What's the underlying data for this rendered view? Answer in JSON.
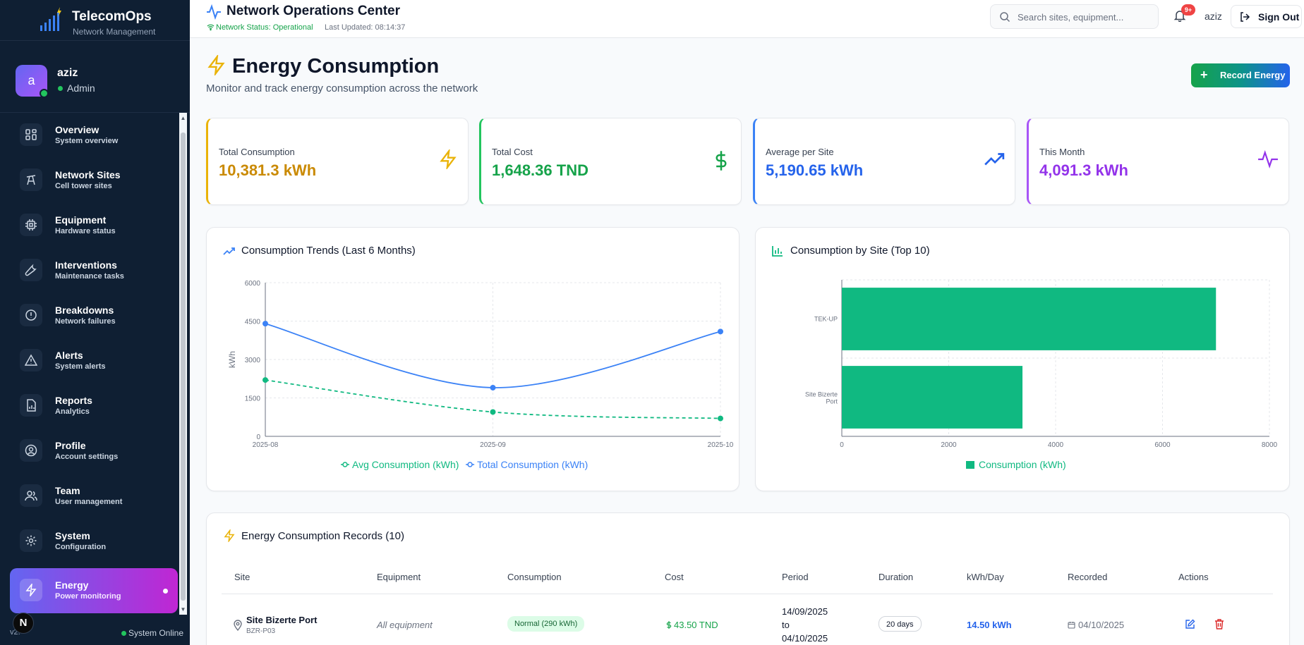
{
  "brand": {
    "name": "TelecomOps",
    "subtitle": "Network Management"
  },
  "user": {
    "initial": "a",
    "name": "aziz",
    "role": "Admin"
  },
  "nav": [
    {
      "label": "Overview",
      "sub": "System overview",
      "icon": "grid-icon"
    },
    {
      "label": "Network Sites",
      "sub": "Cell tower sites",
      "icon": "tower-icon"
    },
    {
      "label": "Equipment",
      "sub": "Hardware status",
      "icon": "chip-icon"
    },
    {
      "label": "Interventions",
      "sub": "Maintenance tasks",
      "icon": "wrench-icon"
    },
    {
      "label": "Breakdowns",
      "sub": "Network failures",
      "icon": "alert-circle-icon"
    },
    {
      "label": "Alerts",
      "sub": "System alerts",
      "icon": "warning-triangle-icon"
    },
    {
      "label": "Reports",
      "sub": "Analytics",
      "icon": "report-icon"
    },
    {
      "label": "Profile",
      "sub": "Account settings",
      "icon": "user-circle-icon"
    },
    {
      "label": "Team",
      "sub": "User management",
      "icon": "users-icon"
    },
    {
      "label": "System",
      "sub": "Configuration",
      "icon": "gear-icon"
    },
    {
      "label": "Energy",
      "sub": "Power monitoring",
      "icon": "bolt-icon",
      "active": true
    }
  ],
  "footer": {
    "version": "v2.",
    "status": "System Online"
  },
  "header": {
    "title": "Network Operations Center",
    "status": "Network Status: Operational",
    "updated": "Last Updated: 08:14:37",
    "search_placeholder": "Search sites, equipment...",
    "notif_badge": "9+",
    "user": "aziz",
    "signout": "Sign Out"
  },
  "page": {
    "title": "Energy Consumption",
    "subtitle": "Monitor and track energy consumption across the network",
    "record_button": "Record Energy"
  },
  "stats": [
    {
      "label": "Total Consumption",
      "value": "10,381.3 kWh",
      "color": "#ca8a04",
      "icon": "bolt-icon"
    },
    {
      "label": "Total Cost",
      "value": "1,648.36 TND",
      "color": "#16a34a",
      "icon": "dollar-icon"
    },
    {
      "label": "Average per Site",
      "value": "5,190.65 kWh",
      "color": "#2563eb",
      "icon": "trend-up-icon"
    },
    {
      "label": "This Month",
      "value": "4,091.3 kWh",
      "color": "#9333ea",
      "icon": "pulse-icon"
    }
  ],
  "trend_chart": {
    "title": "Consumption Trends (Last 6 Months)"
  },
  "site_chart": {
    "title": "Consumption by Site (Top 10)"
  },
  "chart_data": [
    {
      "type": "line",
      "title": "Consumption Trends (Last 6 Months)",
      "ylabel": "kWh",
      "x": [
        "2025-08",
        "2025-09",
        "2025-10"
      ],
      "ylim": [
        0,
        6000
      ],
      "yticks": [
        0,
        1500,
        3000,
        4500,
        6000
      ],
      "grid": true,
      "legend": "bottom",
      "series": [
        {
          "name": "Avg Consumption (kWh)",
          "values": [
            2200,
            950,
            700
          ],
          "color": "#10b981",
          "dashed": true
        },
        {
          "name": "Total Consumption (kWh)",
          "values": [
            4400,
            1900,
            4091.3
          ],
          "color": "#3b82f6",
          "dashed": false
        }
      ]
    },
    {
      "type": "bar",
      "orientation": "horizontal",
      "title": "Consumption by Site (Top 10)",
      "categories": [
        "TEK-UP",
        "Site Bizerte Port"
      ],
      "xlim": [
        0,
        8000
      ],
      "xticks": [
        0,
        2000,
        4000,
        6000,
        8000
      ],
      "grid": true,
      "legend": "bottom",
      "series": [
        {
          "name": "Consumption (kWh)",
          "values": [
            7000,
            3380
          ],
          "color": "#10b981"
        }
      ]
    }
  ],
  "table": {
    "title": "Energy Consumption Records (10)",
    "columns": [
      "Site",
      "Equipment",
      "Consumption",
      "Cost",
      "Period",
      "Duration",
      "kWh/Day",
      "Recorded",
      "Actions"
    ],
    "rows": [
      {
        "site": "Site Bizerte Port",
        "site_code": "BZR-P03",
        "equipment": "All equipment",
        "consumption": "Normal (290 kWh)",
        "cost": "43.50 TND",
        "period_start": "14/09/2025",
        "period_to": "to",
        "period_end": "04/10/2025",
        "duration": "20 days",
        "kwh_day": "14.50 kWh",
        "recorded": "04/10/2025"
      }
    ]
  }
}
